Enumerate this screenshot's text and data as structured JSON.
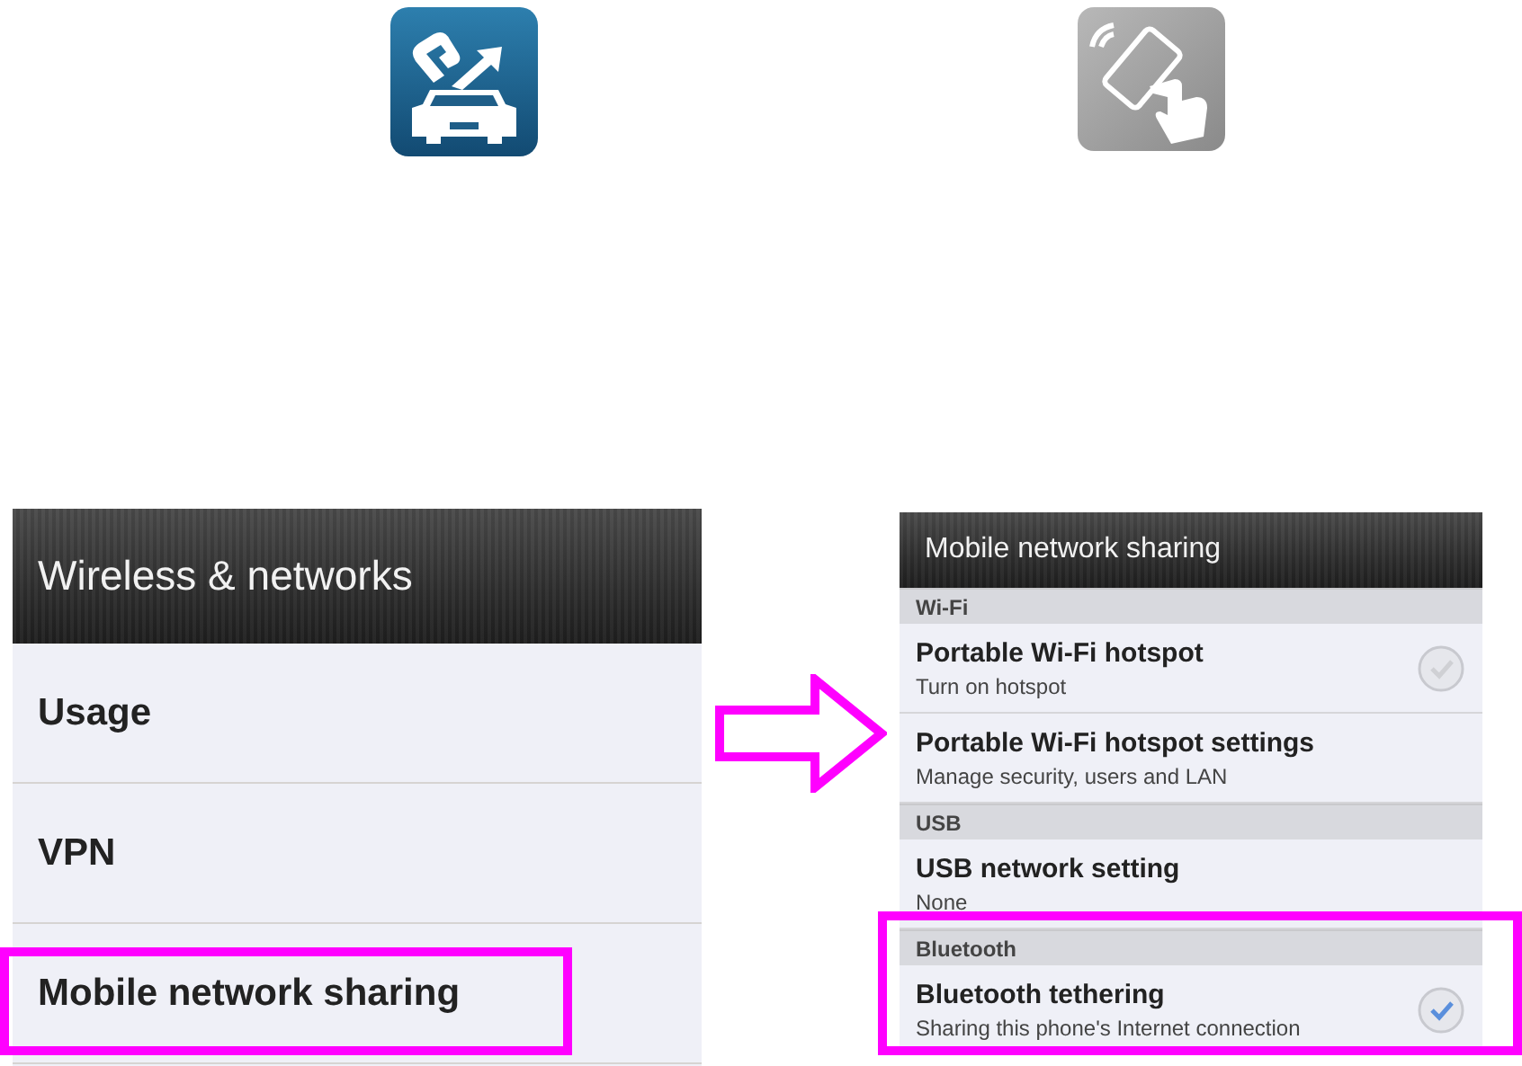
{
  "app_icons": [
    {
      "kind": "car"
    },
    {
      "kind": "tap"
    }
  ],
  "left_screen": {
    "title": "Wireless & networks",
    "items": [
      {
        "label": "Usage",
        "highlighted": false
      },
      {
        "label": "VPN",
        "highlighted": false
      },
      {
        "label": "Mobile network sharing",
        "highlighted": true
      }
    ]
  },
  "right_screen": {
    "title": "Mobile network sharing",
    "sections": [
      {
        "header": "Wi-Fi",
        "highlighted": false,
        "items": [
          {
            "kind": "check",
            "title": "Portable Wi-Fi hotspot",
            "subtitle": "Turn on hotspot",
            "checked": false
          },
          {
            "kind": "plain",
            "title": "Portable Wi-Fi hotspot settings",
            "subtitle": "Manage security, users and LAN"
          }
        ]
      },
      {
        "header": "USB",
        "highlighted": false,
        "items": [
          {
            "kind": "plain",
            "title": "USB network setting",
            "subtitle": "None"
          }
        ]
      },
      {
        "header": "Bluetooth",
        "highlighted": true,
        "items": [
          {
            "kind": "check",
            "title": "Bluetooth tethering",
            "subtitle": "Sharing this phone's Internet connection",
            "checked": true
          }
        ]
      }
    ]
  }
}
